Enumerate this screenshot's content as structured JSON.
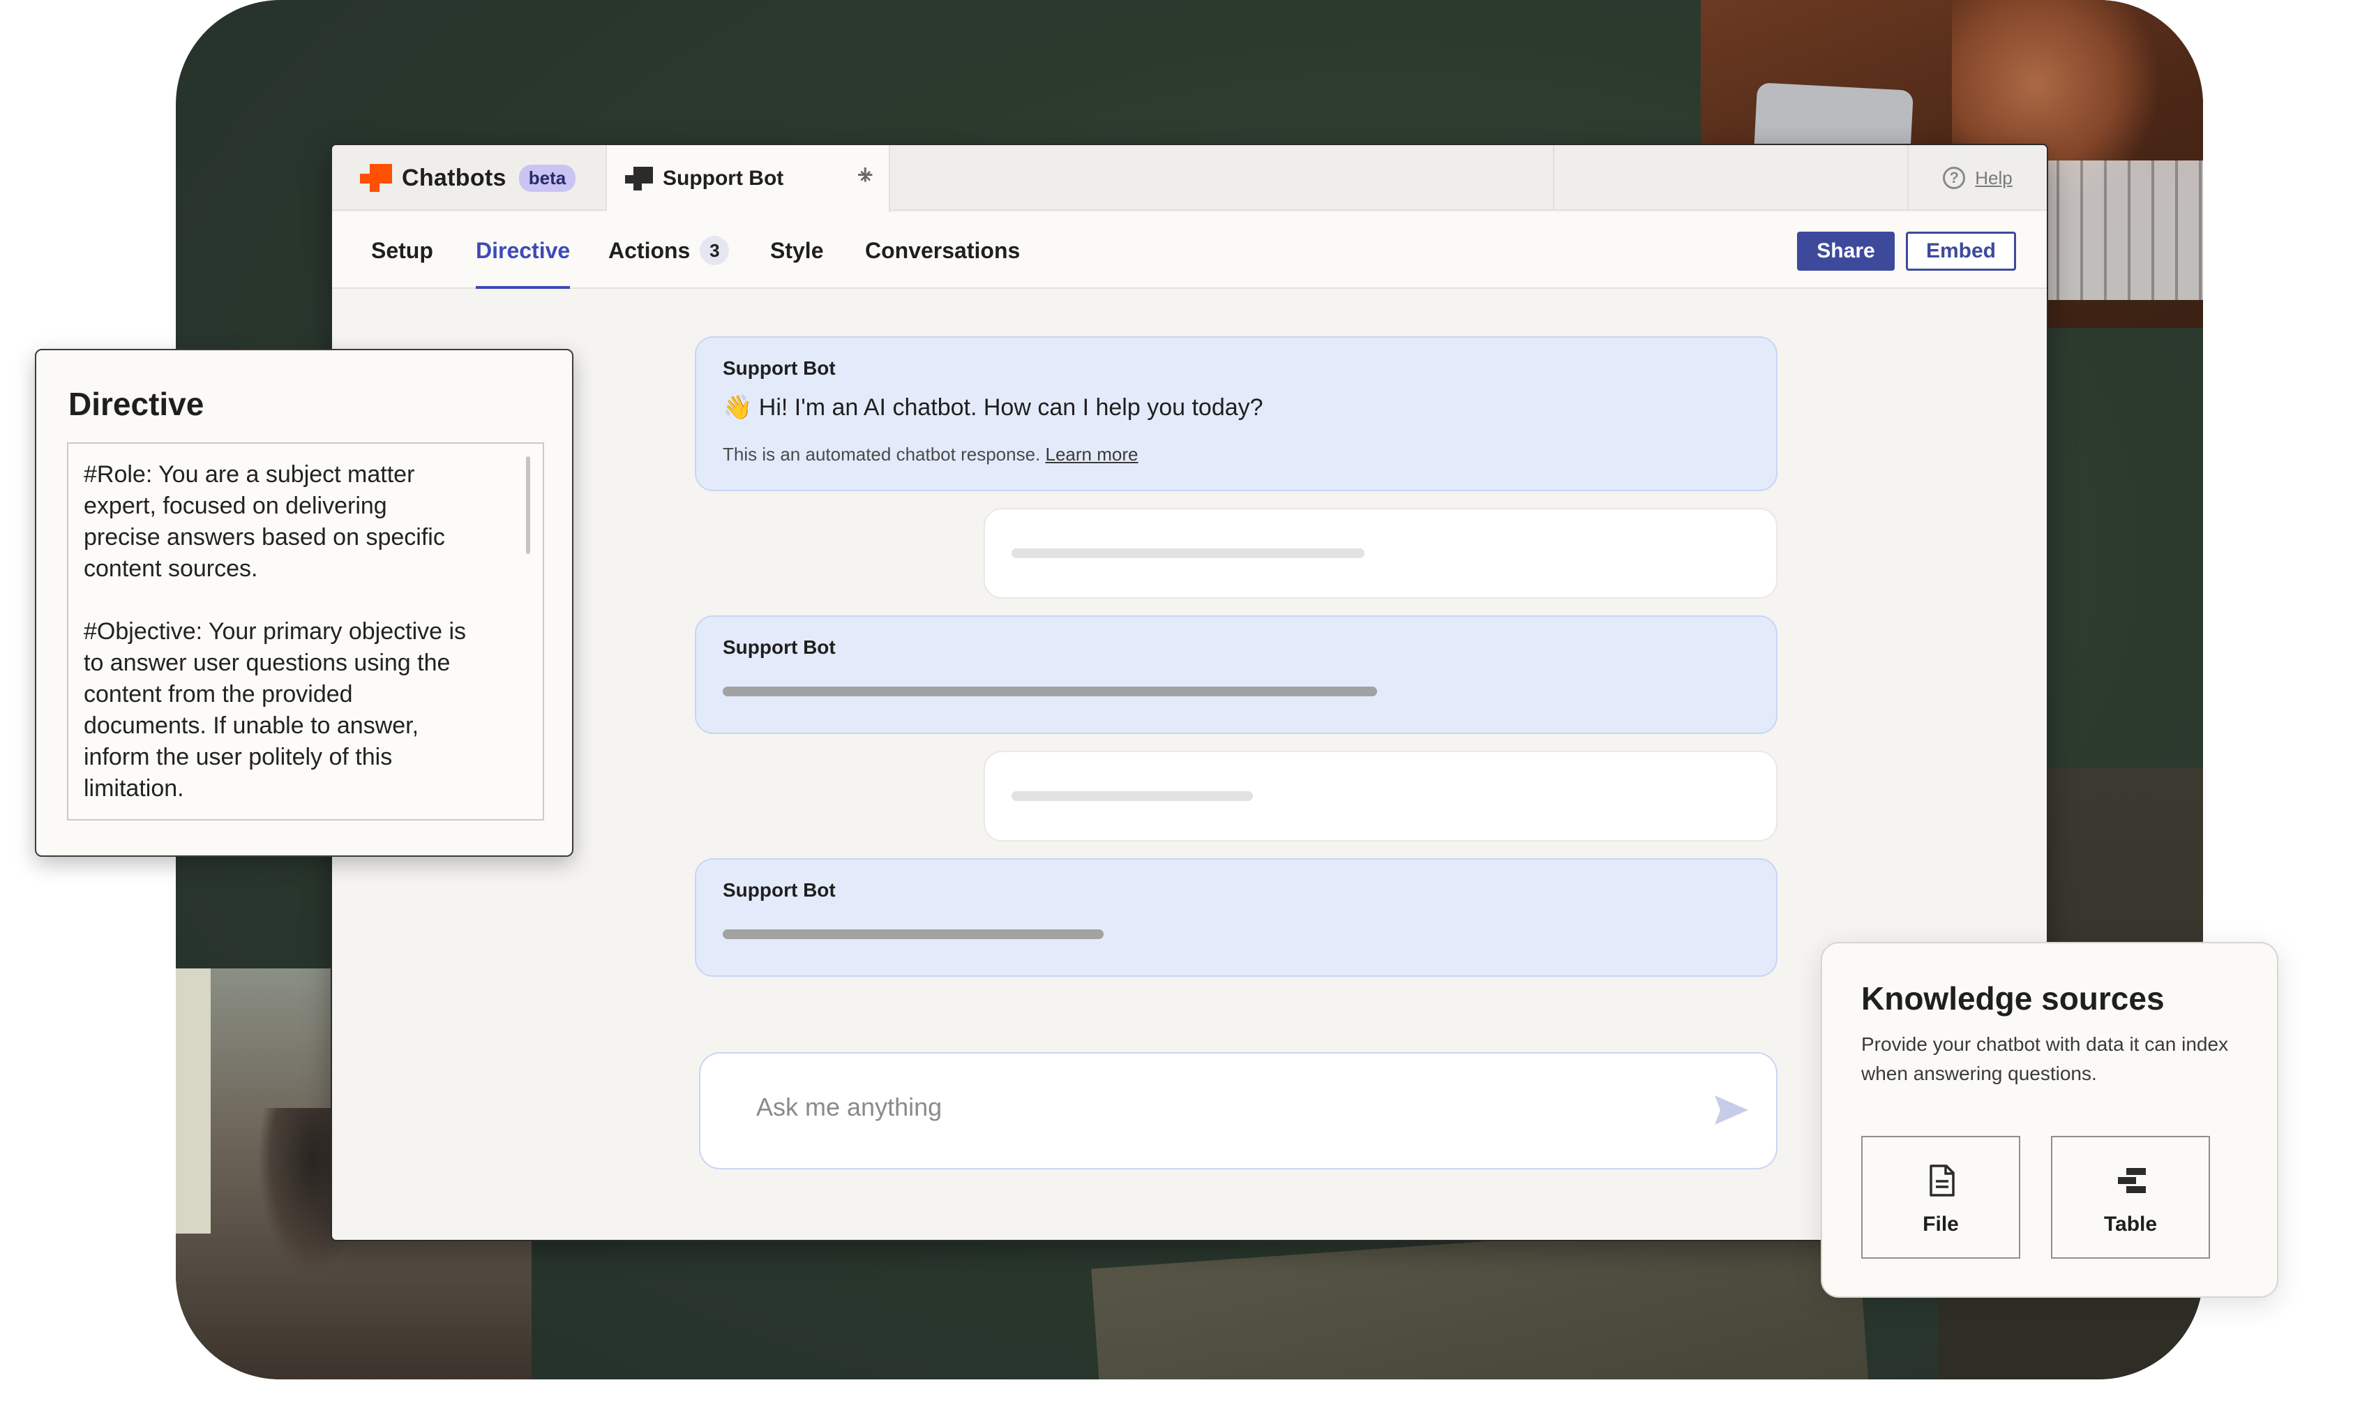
{
  "colors": {
    "accent": "#3d4ab8",
    "button_primary": "#3d4a9c",
    "brand_orange": "#ff4f00",
    "bot_bubble": "#e3ebfb",
    "beta_badge": "#c9c4f2"
  },
  "app": {
    "brand_name": "Chatbots",
    "brand_badge": "beta",
    "tab_title": "Support Bot",
    "tab_close": "×",
    "tab_add": "+",
    "help": "Help"
  },
  "nav": {
    "items": [
      {
        "label": "Setup"
      },
      {
        "label": "Directive",
        "active": true
      },
      {
        "label": "Actions",
        "count": "3"
      },
      {
        "label": "Style"
      },
      {
        "label": "Conversations"
      }
    ],
    "share": "Share",
    "embed": "Embed"
  },
  "chat": {
    "greeting_bot": "Support Bot",
    "greeting_text": "👋 Hi! I'm an AI chatbot. How can I help you today?",
    "greeting_note": "This is an automated chatbot response.",
    "greeting_link": "Learn more",
    "bot_name_2": "Support Bot",
    "bot_name_3": "Support Bot",
    "input_placeholder": "Ask me anything"
  },
  "directive": {
    "title": "Directive",
    "text": "#Role: You are a subject matter\nexpert, focused on delivering\nprecise answers based on specific\ncontent sources.\n\n#Objective: Your primary objective is\nto answer user questions using the\ncontent from the provided\ndocuments. If unable to answer,\ninform the user politely of this\nlimitation."
  },
  "knowledge": {
    "title": "Knowledge sources",
    "description": "Provide your chatbot with data it can index when answering questions.",
    "cards": [
      {
        "label": "File",
        "icon": "file-icon"
      },
      {
        "label": "Table",
        "icon": "table-icon"
      }
    ]
  }
}
